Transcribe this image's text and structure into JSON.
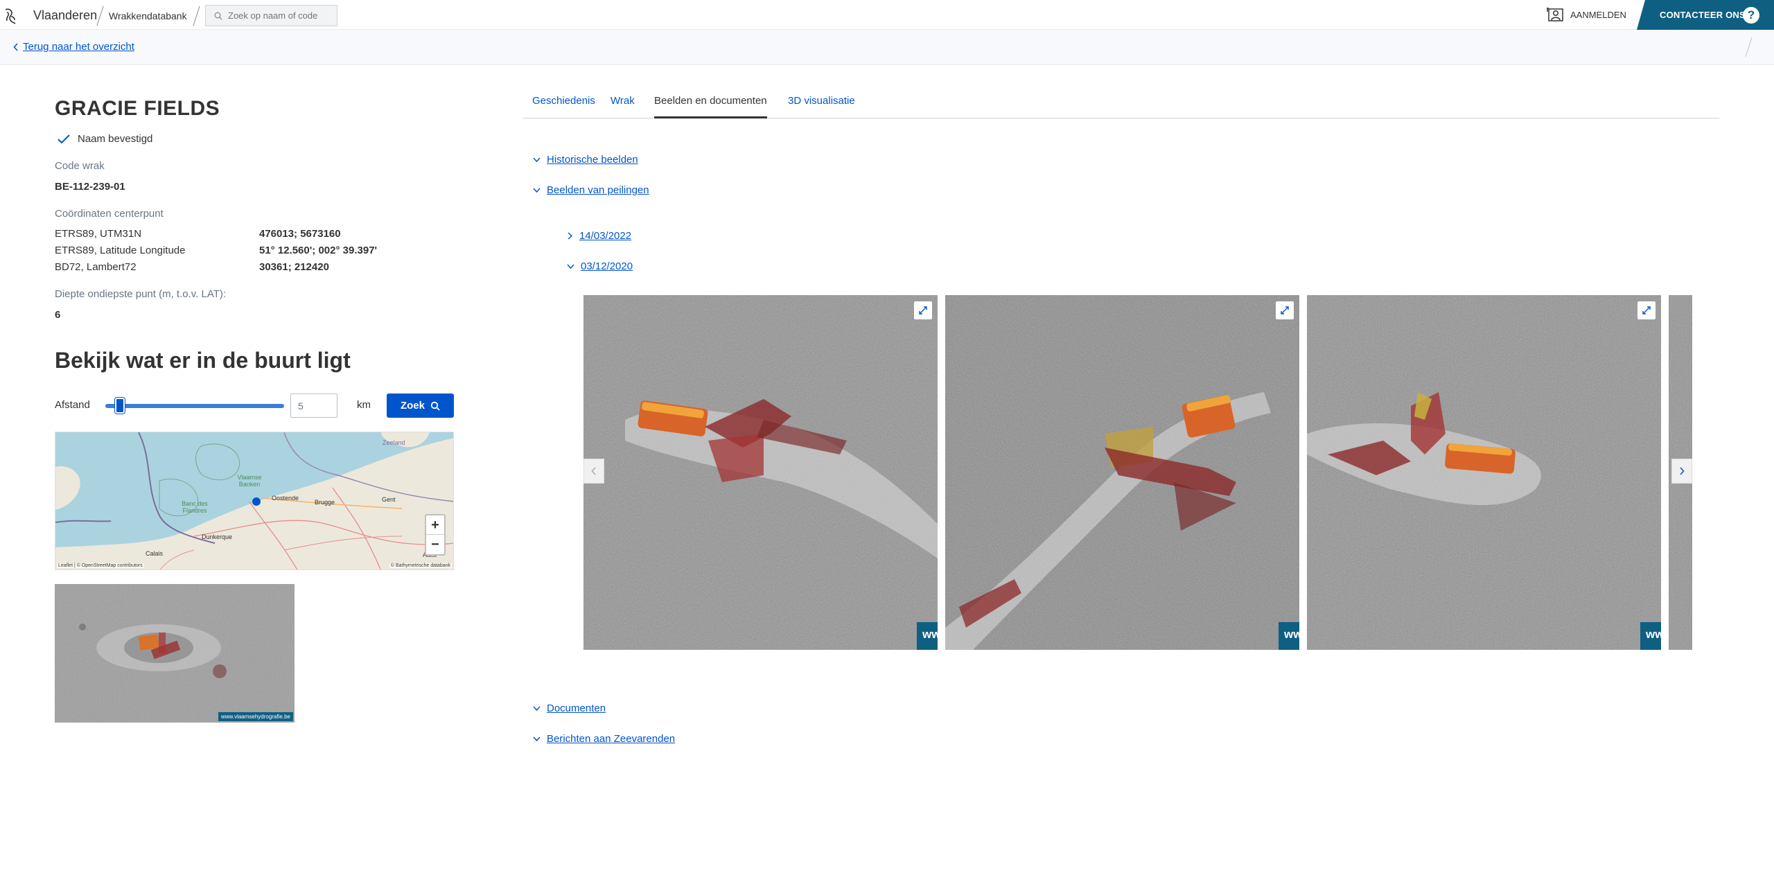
{
  "header": {
    "brand": "Vlaanderen",
    "app_name": "Wrakkendatabank",
    "search_placeholder": "Zoek op naam of code",
    "login_label": "AANMELDEN",
    "contact_label": "CONTACTEER ONS",
    "help_label": "?"
  },
  "subheader": {
    "back_label": "Terug naar het overzicht"
  },
  "wreck": {
    "name": "GRACIE FIELDS",
    "name_status": "Naam bevestigd",
    "code_label": "Code wrak",
    "code": "BE-112-239-01",
    "coords_label": "Coördinaten centerpunt",
    "coords": [
      {
        "system": "ETRS89, UTM31N",
        "value": "476013; 5673160"
      },
      {
        "system": "ETRS89, Latitude Longitude",
        "value": "51° 12.560'; 002° 39.397'"
      },
      {
        "system": "BD72, Lambert72",
        "value": "30361; 212420"
      }
    ],
    "depth_label": "Diepte ondiepste punt (m, t.o.v. LAT):",
    "depth": "6"
  },
  "nearby": {
    "heading": "Bekijk wat er in de buurt ligt",
    "distance_label": "Afstand",
    "distance_value": "5",
    "slider_fraction": 0.05,
    "unit": "km",
    "search_label": "Zoek"
  },
  "map": {
    "labels": [
      "Zeeland",
      "Vlaamse Banken",
      "Oostende",
      "Brugge",
      "Banc des Flandres",
      "Dunkerque",
      "Calais",
      "Gent",
      "Aalst"
    ],
    "zoom_in": "+",
    "zoom_out": "−",
    "attribution_left": "Leaflet | © OpenStreetMap contributors",
    "attribution_right": "© Bathymetrische databank"
  },
  "thumb_watermark": "www.vlaamsehydrografie.be",
  "tabs": [
    {
      "label": "Geschiedenis",
      "active": false
    },
    {
      "label": "Wrak",
      "active": false
    },
    {
      "label": "Beelden en documenten",
      "active": true
    },
    {
      "label": "3D visualisatie",
      "active": false
    }
  ],
  "sections": {
    "historical": "Historische beelden",
    "surveys": "Beelden van peilingen",
    "survey_dates": [
      "14/03/2022",
      "03/12/2020"
    ],
    "documents": "Documenten",
    "notices": "Berichten aan Zeevarenden"
  },
  "carousel": {
    "watermark": "ww"
  },
  "colors": {
    "primary": "#0055cc",
    "brand_teal": "#0f5f82",
    "text": "#333332",
    "muted": "#687483"
  }
}
